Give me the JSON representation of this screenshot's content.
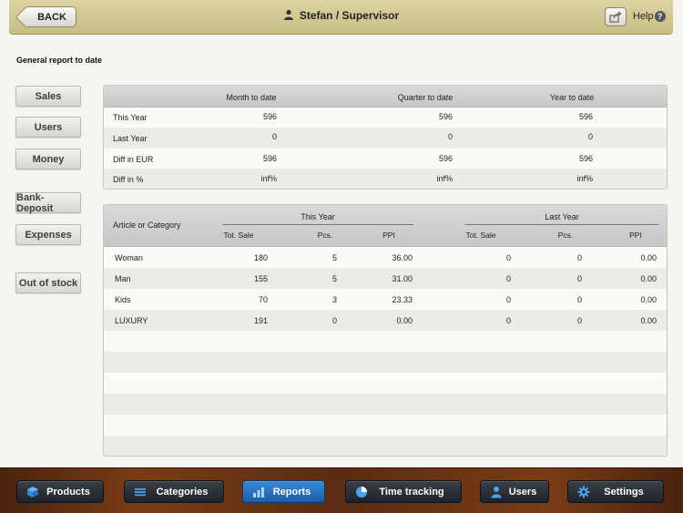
{
  "header": {
    "back_label": "BACK",
    "title": "Stefan / Supervisor",
    "help_label": "Help",
    "help_icon_glyph": "?"
  },
  "page_label": "General report to date",
  "sidebar": [
    {
      "label": "Sales"
    },
    {
      "label": "Users"
    },
    {
      "label": "Money"
    },
    {
      "label": "Bank-Deposit"
    },
    {
      "label": "Expenses"
    },
    {
      "label": "Out of stock"
    }
  ],
  "summary": {
    "columns": [
      "Month to date",
      "Quarter to date",
      "Year to date"
    ],
    "rows": [
      {
        "label": "This Year",
        "values": [
          "596",
          "596",
          "596"
        ]
      },
      {
        "label": "Last Year",
        "values": [
          "0",
          "0",
          "0"
        ]
      },
      {
        "label": "Diff in EUR",
        "values": [
          "596",
          "596",
          "596"
        ]
      },
      {
        "label": "Diff in %",
        "values": [
          "inf%",
          "inf%",
          "inf%"
        ]
      }
    ]
  },
  "categories": {
    "first_header": "Article or Category",
    "group_this_year": "This Year",
    "group_last_year": "Last Year",
    "sub_headers": [
      "Tot. Sale",
      "Pcs.",
      "PPI",
      "Tot. Sale",
      "Pcs.",
      "PPI"
    ],
    "rows": [
      {
        "name": "Woman",
        "values": [
          "180",
          "5",
          "36.00",
          "0",
          "0",
          "0.00"
        ]
      },
      {
        "name": "Man",
        "values": [
          "155",
          "5",
          "31.00",
          "0",
          "0",
          "0.00"
        ]
      },
      {
        "name": "Kids",
        "values": [
          "70",
          "3",
          "23.33",
          "0",
          "0",
          "0.00"
        ]
      },
      {
        "name": "LUXURY",
        "values": [
          "191",
          "0",
          "0.00",
          "0",
          "0",
          "0.00"
        ]
      }
    ]
  },
  "footer_tabs": [
    {
      "label": "Products",
      "icon": "cube-icon"
    },
    {
      "label": "Categories",
      "icon": "list-icon"
    },
    {
      "label": "Reports",
      "icon": "bar-chart-icon",
      "active": true
    },
    {
      "label": "Time tracking",
      "icon": "pie-chart-icon"
    },
    {
      "label": "Users",
      "icon": "user-icon"
    },
    {
      "label": "Settings",
      "icon": "gear-icon"
    }
  ],
  "colors": {
    "active_tab": "#2a74c4",
    "header_bg": "#d6cc98",
    "footer_wood": "#6a3414",
    "icon_blue": "#4aa3f0"
  }
}
